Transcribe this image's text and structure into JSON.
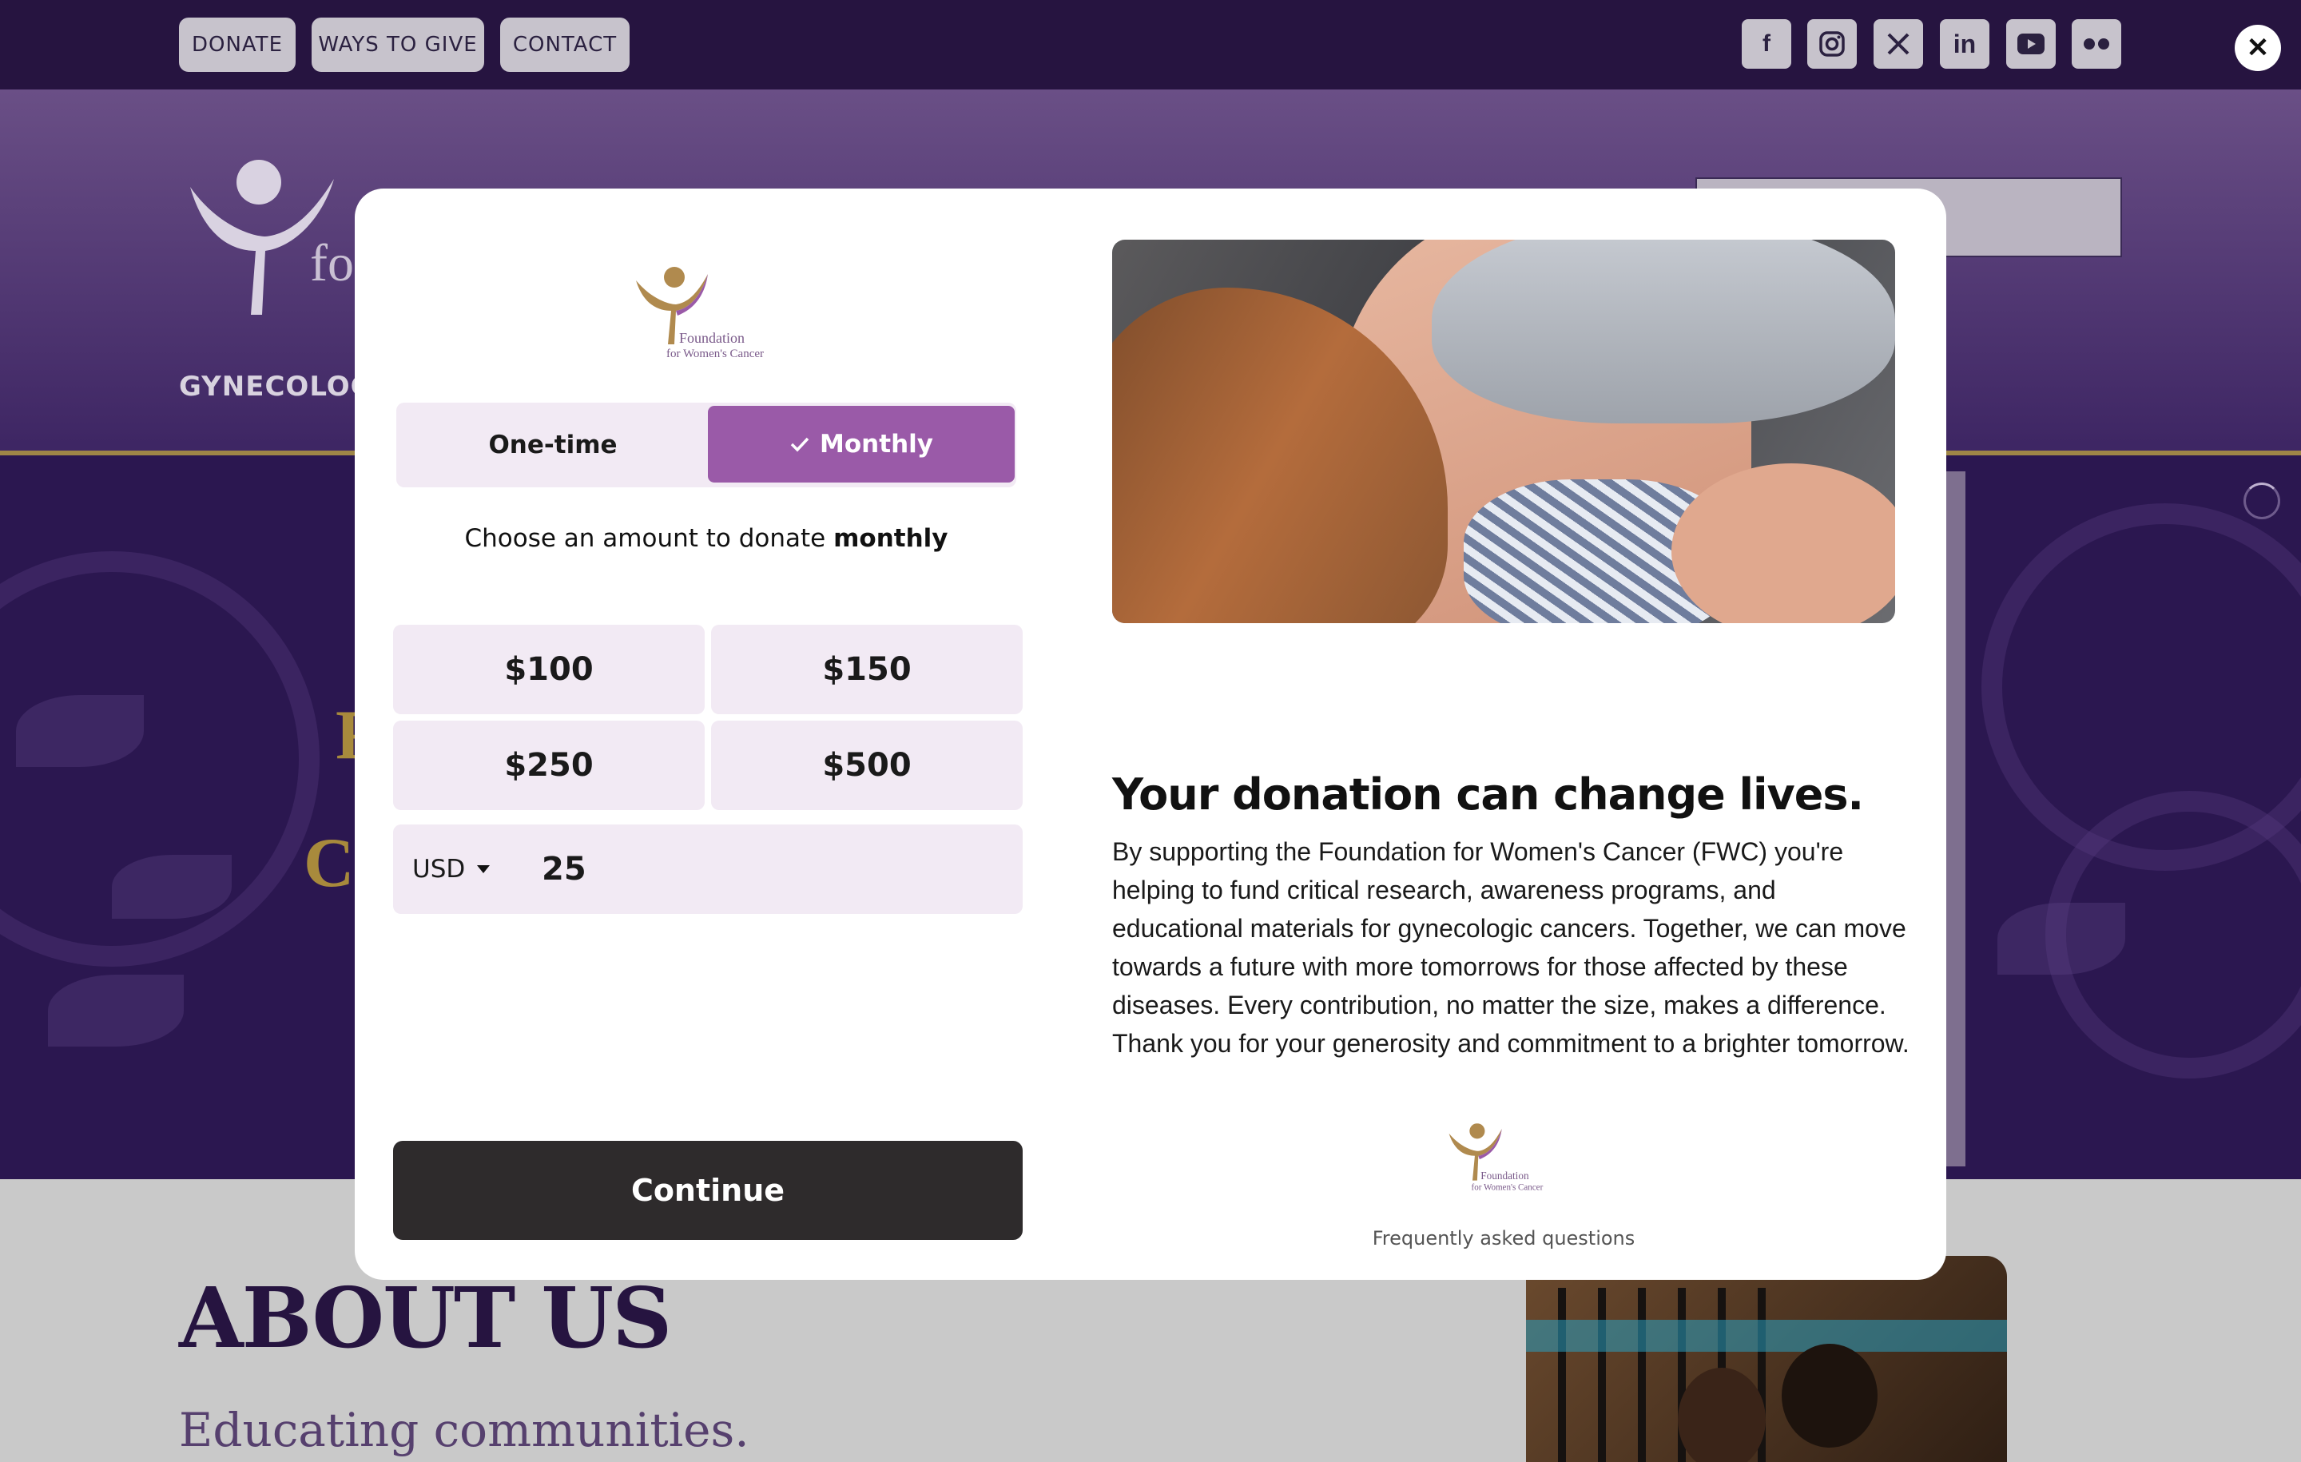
{
  "topbar": {
    "buttons": [
      "DONATE",
      "WAYS TO GIVE",
      "CONTACT"
    ],
    "social_icons": [
      "facebook-icon",
      "instagram-icon",
      "x-icon",
      "linkedin-icon",
      "youtube-icon",
      "flickr-icon"
    ],
    "close_symbol": "✕"
  },
  "header": {
    "logo_partial": "fo",
    "nav_partial": "GYNECOLOGI"
  },
  "hero": {
    "partial_line1": "F",
    "partial_line2": "C"
  },
  "about": {
    "title": "ABOUT US",
    "subtitle": "Educating communities."
  },
  "modal": {
    "logo_text_1": "Foundation",
    "logo_text_2": "for Women's Cancer",
    "frequency": {
      "one_time_label": "One-time",
      "monthly_label": "Monthly",
      "selected": "monthly"
    },
    "choose_prefix": "Choose an amount to donate ",
    "choose_emphasis": "monthly",
    "amounts": [
      "$100",
      "$150",
      "$250",
      "$500"
    ],
    "currency": "USD",
    "custom_amount": "25",
    "continue_label": "Continue",
    "headline": "Your donation can change lives.",
    "body": "By supporting the Foundation for Women's Cancer (FWC) you're helping to fund critical research, awareness programs, and educational materials for gynecologic cancers. Together, we can move towards a future with more tomorrows for those affected by these diseases. Every contribution, no matter the size, makes a difference. Thank you for your generosity and commitment to a brighter tomorrow.",
    "faq_label": "Frequently asked questions"
  },
  "colors": {
    "brand_purple": "#9a5aa8",
    "dark_purple": "#261440",
    "gold": "#a88a3c",
    "button_dark": "#2e2b2c"
  }
}
